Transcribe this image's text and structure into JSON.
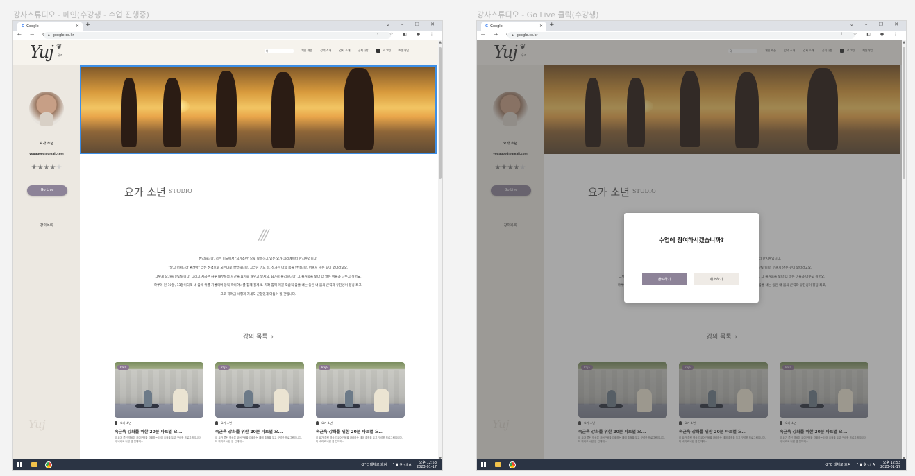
{
  "artboards": [
    {
      "title": "강사스튜디오 - 메인(수강생 - 수업 진행중)"
    },
    {
      "title": "강사스튜디오 - Go Live 클릭(수강생)"
    }
  ],
  "browser": {
    "tab_title": "Google",
    "tab_close": "×",
    "new_tab": "+",
    "window_controls": "⌄ – ❐ ✕",
    "nav_buttons": "← → C",
    "url": "google.co.kr",
    "addr_icons": "⇪ ☆ ◧ ● ⋮"
  },
  "site": {
    "logo": "Yuj",
    "logo_sub": "유즈",
    "search_placeholder": "Q",
    "nav": [
      "개인 레슨",
      "강의 소개",
      "강사 소개",
      "공지사항",
      "로그인",
      "회원가입"
    ]
  },
  "sidebar": {
    "name": "요가 소년",
    "email": "yogagood@gmail.com",
    "rating": 4,
    "stars_on": "★★★★",
    "stars_off": "★",
    "go_live": "Go Live",
    "course_list": "강의목록",
    "logo": "Yuj"
  },
  "studio": {
    "title": "요가 소년",
    "subtitle": "STUDIO",
    "slashes": "///",
    "bio": [
      "반갑습니다. 저는 미국에서 '요가소년' 으로 활동하고 있는 요가 크리에이터 한지훈입니다.",
      "\"말고 어쩌나라 괜찮아\" 라는 성격으로 되는대로 살았습니다. 그러던 어느 날, 정가진 나의 몸을 만났니다. 어쩌지 않은 곳이 없더라고요.",
      "그렇게 요가를 만났습니다. 그리고 지금은 하루 대부분의 시간을 요가로 채우고 있지요. 요가로 즐겁습니다. 그 즐거움을 보다 더 많은 이들과 나누고 싶어요.",
      "하루에 단 10분, 15분이라도 내 몸에 귀를 기울이며 동작 하나하나를 함께 할게요. 저와 함께 매일 조금씩 몸을 내는 동안 내 몸의 근력과 유연성이 향상 되고,",
      "그로 하여금 세형과 자세도 균형있게 다듬어 질 것입니다."
    ],
    "courses_heading": "강의 목록",
    "courses_chevron": "›"
  },
  "courses": [
    {
      "badge": "Raja",
      "teacher": "요가 소년",
      "title": "속근육 강화를 위한 20분 파트별 요...",
      "desc": "이 요가 루틴 영상은 코어근육을 강화하는 데에 초점을 두고 구성한 프로그램입니다. 더 바리고 나은 몸 전체에..."
    },
    {
      "badge": "Raja",
      "teacher": "요가 소년",
      "title": "속근육 강화를 위한 20분 파트별 요...",
      "desc": "이 요가 루틴 영상은 코어근육을 강화하는 데에 초점을 두고 구성한 프로그램입니다. 더 바리고 나은 몸 전체에..."
    },
    {
      "badge": "Raja",
      "teacher": "요가 소년",
      "title": "속근육 강화를 위한 20분 파트별 요...",
      "desc": "이 요가 루틴 영상은 코어근육을 강화하는 데에 초점을 두고 구성한 프로그램입니다. 더 바리고 나은 몸 전체에..."
    }
  ],
  "dialog": {
    "question": "수업에 참여하시겠습니까?",
    "join": "참여하기",
    "cancel": "취소하기"
  },
  "taskbar": {
    "weather": "-2°C 대체로 흐림",
    "tray": "^ ▮ 令 ◁) A",
    "time": "오후 12:53",
    "date": "2023-01-17"
  },
  "colors": {
    "accent_purple": "#8d8398",
    "sidebar_bg": "#ece8e1",
    "header_bg": "#f6f3ed",
    "selection_blue": "#3d8ee5"
  }
}
